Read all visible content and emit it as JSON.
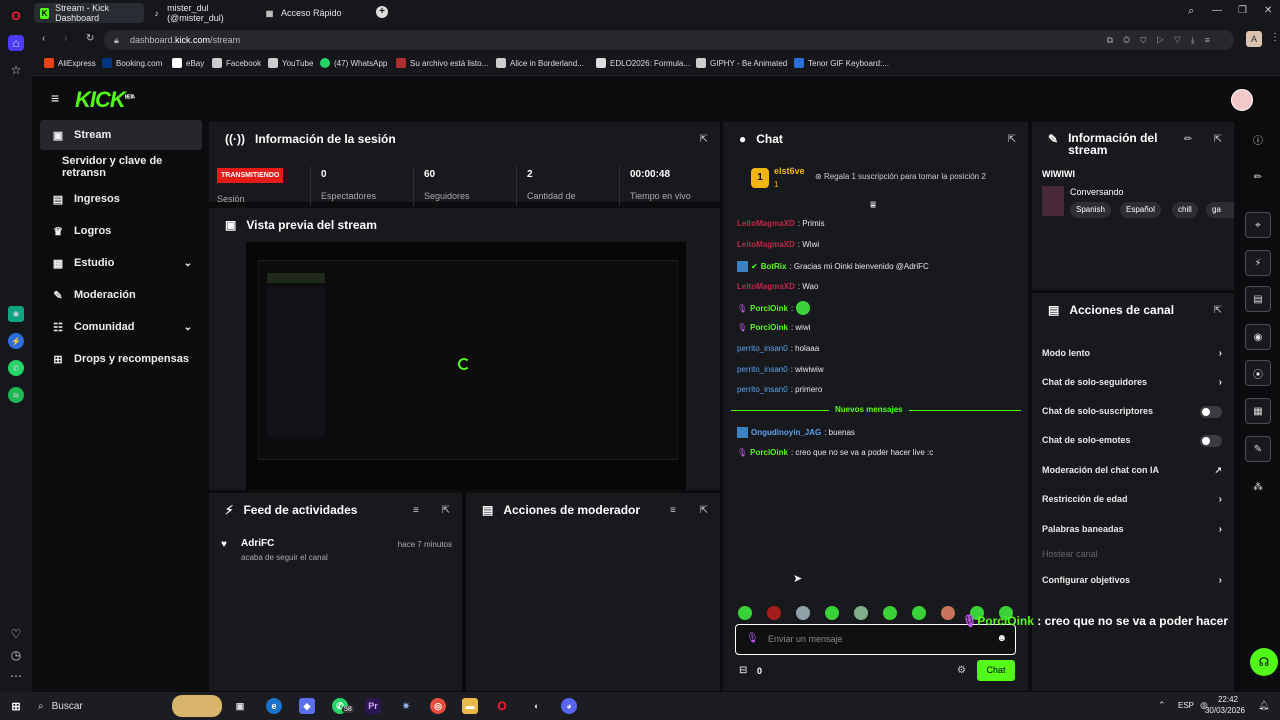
{
  "browser": {
    "tabs": [
      {
        "label": "Stream - Kick Dashboard",
        "icon": "kick-icon"
      },
      {
        "label": "mister_dul (@mister_dul)",
        "icon": "tiktok-icon"
      },
      {
        "label": "Acceso Rápido",
        "icon": "grid-icon"
      }
    ],
    "url_prefix": "dashboard.",
    "url_domain": "kick.com",
    "url_path": "/stream",
    "bookmarks": [
      "AliExpress",
      "Booking.com",
      "eBay",
      "Facebook",
      "YouTube",
      "(47) WhatsApp",
      "Su archivo está listo...",
      "Alice in Borderland...",
      "EDLO2026: Formula...",
      "GIPHY - Be Animated",
      "Tenor GIF Keyboard:..."
    ],
    "profile_letter": "A"
  },
  "brand": {
    "logo": "KICK",
    "beta": "BETA",
    "accent": "#53fc18"
  },
  "nav": {
    "items": [
      {
        "label": "Stream",
        "icon": "stream-icon"
      },
      {
        "label": "Servidor y clave de retransn",
        "icon": ""
      },
      {
        "label": "Ingresos",
        "icon": "money-icon"
      },
      {
        "label": "Logros",
        "icon": "trophy-icon"
      },
      {
        "label": "Estudio",
        "icon": "studio-icon"
      },
      {
        "label": "Moderación",
        "icon": "wrench-icon"
      },
      {
        "label": "Comunidad",
        "icon": "community-icon"
      },
      {
        "label": "Drops y recompensas",
        "icon": "gift-icon"
      }
    ]
  },
  "session": {
    "title": "Información de la sesión",
    "status": "TRANSMITIENDO",
    "status_label": "Sesión",
    "stats": [
      {
        "value": "0",
        "label": "Espectadores"
      },
      {
        "value": "60",
        "label": "Seguidores"
      },
      {
        "value": "2",
        "label": "Cantidad de"
      },
      {
        "value": "00:00:48",
        "label": "Tiempo en vivo"
      }
    ]
  },
  "preview": {
    "title": "Vista previa del stream"
  },
  "feed": {
    "title": "Feed de actividades",
    "items": [
      {
        "user": "AdriFC",
        "action": "acaba de seguir el canal",
        "time": "hace 7 minutos"
      }
    ]
  },
  "modactions": {
    "title": "Acciones de moderador"
  },
  "chat": {
    "title": "Chat",
    "pinned_user": "elst6ve",
    "pinned_rank": "1",
    "pinned_text": "Regala 1 suscripción para tomar la posición 2",
    "messages": [
      {
        "user": "LeitoMagmaXD",
        "text": ": Primis",
        "color": "#c0264a"
      },
      {
        "user": "LeitoMagmaXD",
        "text": ": Wiwi",
        "color": "#c0264a"
      },
      {
        "user": "BotRix",
        "text": ": Gracias mi Oinki bienvenido @AdriFC",
        "color": "#53fc18"
      },
      {
        "user": "LeitoMagmaXD",
        "text": ": Wao",
        "color": "#c0264a"
      },
      {
        "user": "PorciOink",
        "text": ":",
        "color": "#53fc18"
      },
      {
        "user": "PorciOink",
        "text": ": wiwi",
        "color": "#53fc18"
      },
      {
        "user": "perrito_insan0",
        "text": ": holaaa",
        "color": "#5aa3f0"
      },
      {
        "user": "perrito_insan0",
        "text": ": wiwiwiw",
        "color": "#5aa3f0"
      },
      {
        "user": "perrito_insan0",
        "text": ": primero",
        "color": "#5aa3f0"
      },
      {
        "user": "Ongudinoyin_JAG",
        "text": ": buenas",
        "color": "#5aa3f0"
      },
      {
        "user": "PorciOink",
        "text": ": creo que no se va a poder hacer live :c",
        "color": "#53fc18"
      }
    ],
    "new_messages": "Nuevos mensajes",
    "input_placeholder": "Enviar un mensaje",
    "points": "0",
    "send_label": "Chat"
  },
  "stream_info": {
    "title": "Información del stream",
    "stream_title": "WIWIWI",
    "category": "Conversando",
    "tags": [
      "Spanish",
      "Español",
      "chill",
      "ga"
    ]
  },
  "channel_actions": {
    "title": "Acciones de canal",
    "items": [
      {
        "label": "Modo lento",
        "control": "arrow"
      },
      {
        "label": "Chat de solo-seguidores",
        "control": "arrow"
      },
      {
        "label": "Chat de solo-suscriptores",
        "control": "toggle"
      },
      {
        "label": "Chat de solo-emotes",
        "control": "toggle"
      },
      {
        "label": "Moderación del chat con IA",
        "control": "external"
      },
      {
        "label": "Restricción de edad",
        "control": "arrow"
      },
      {
        "label": "Palabras baneadas",
        "control": "arrow"
      },
      {
        "label": "Hostear canal",
        "control": "disabled"
      },
      {
        "label": "Configurar objetivos",
        "control": "arrow"
      }
    ]
  },
  "overlay": {
    "user": "PorciOink",
    "text": " : creo que no se va a poder hacer"
  },
  "taskbar": {
    "search": "Buscar",
    "lang": "ESP",
    "time": "22:42",
    "date": "30/03/2026",
    "badge": "58"
  }
}
